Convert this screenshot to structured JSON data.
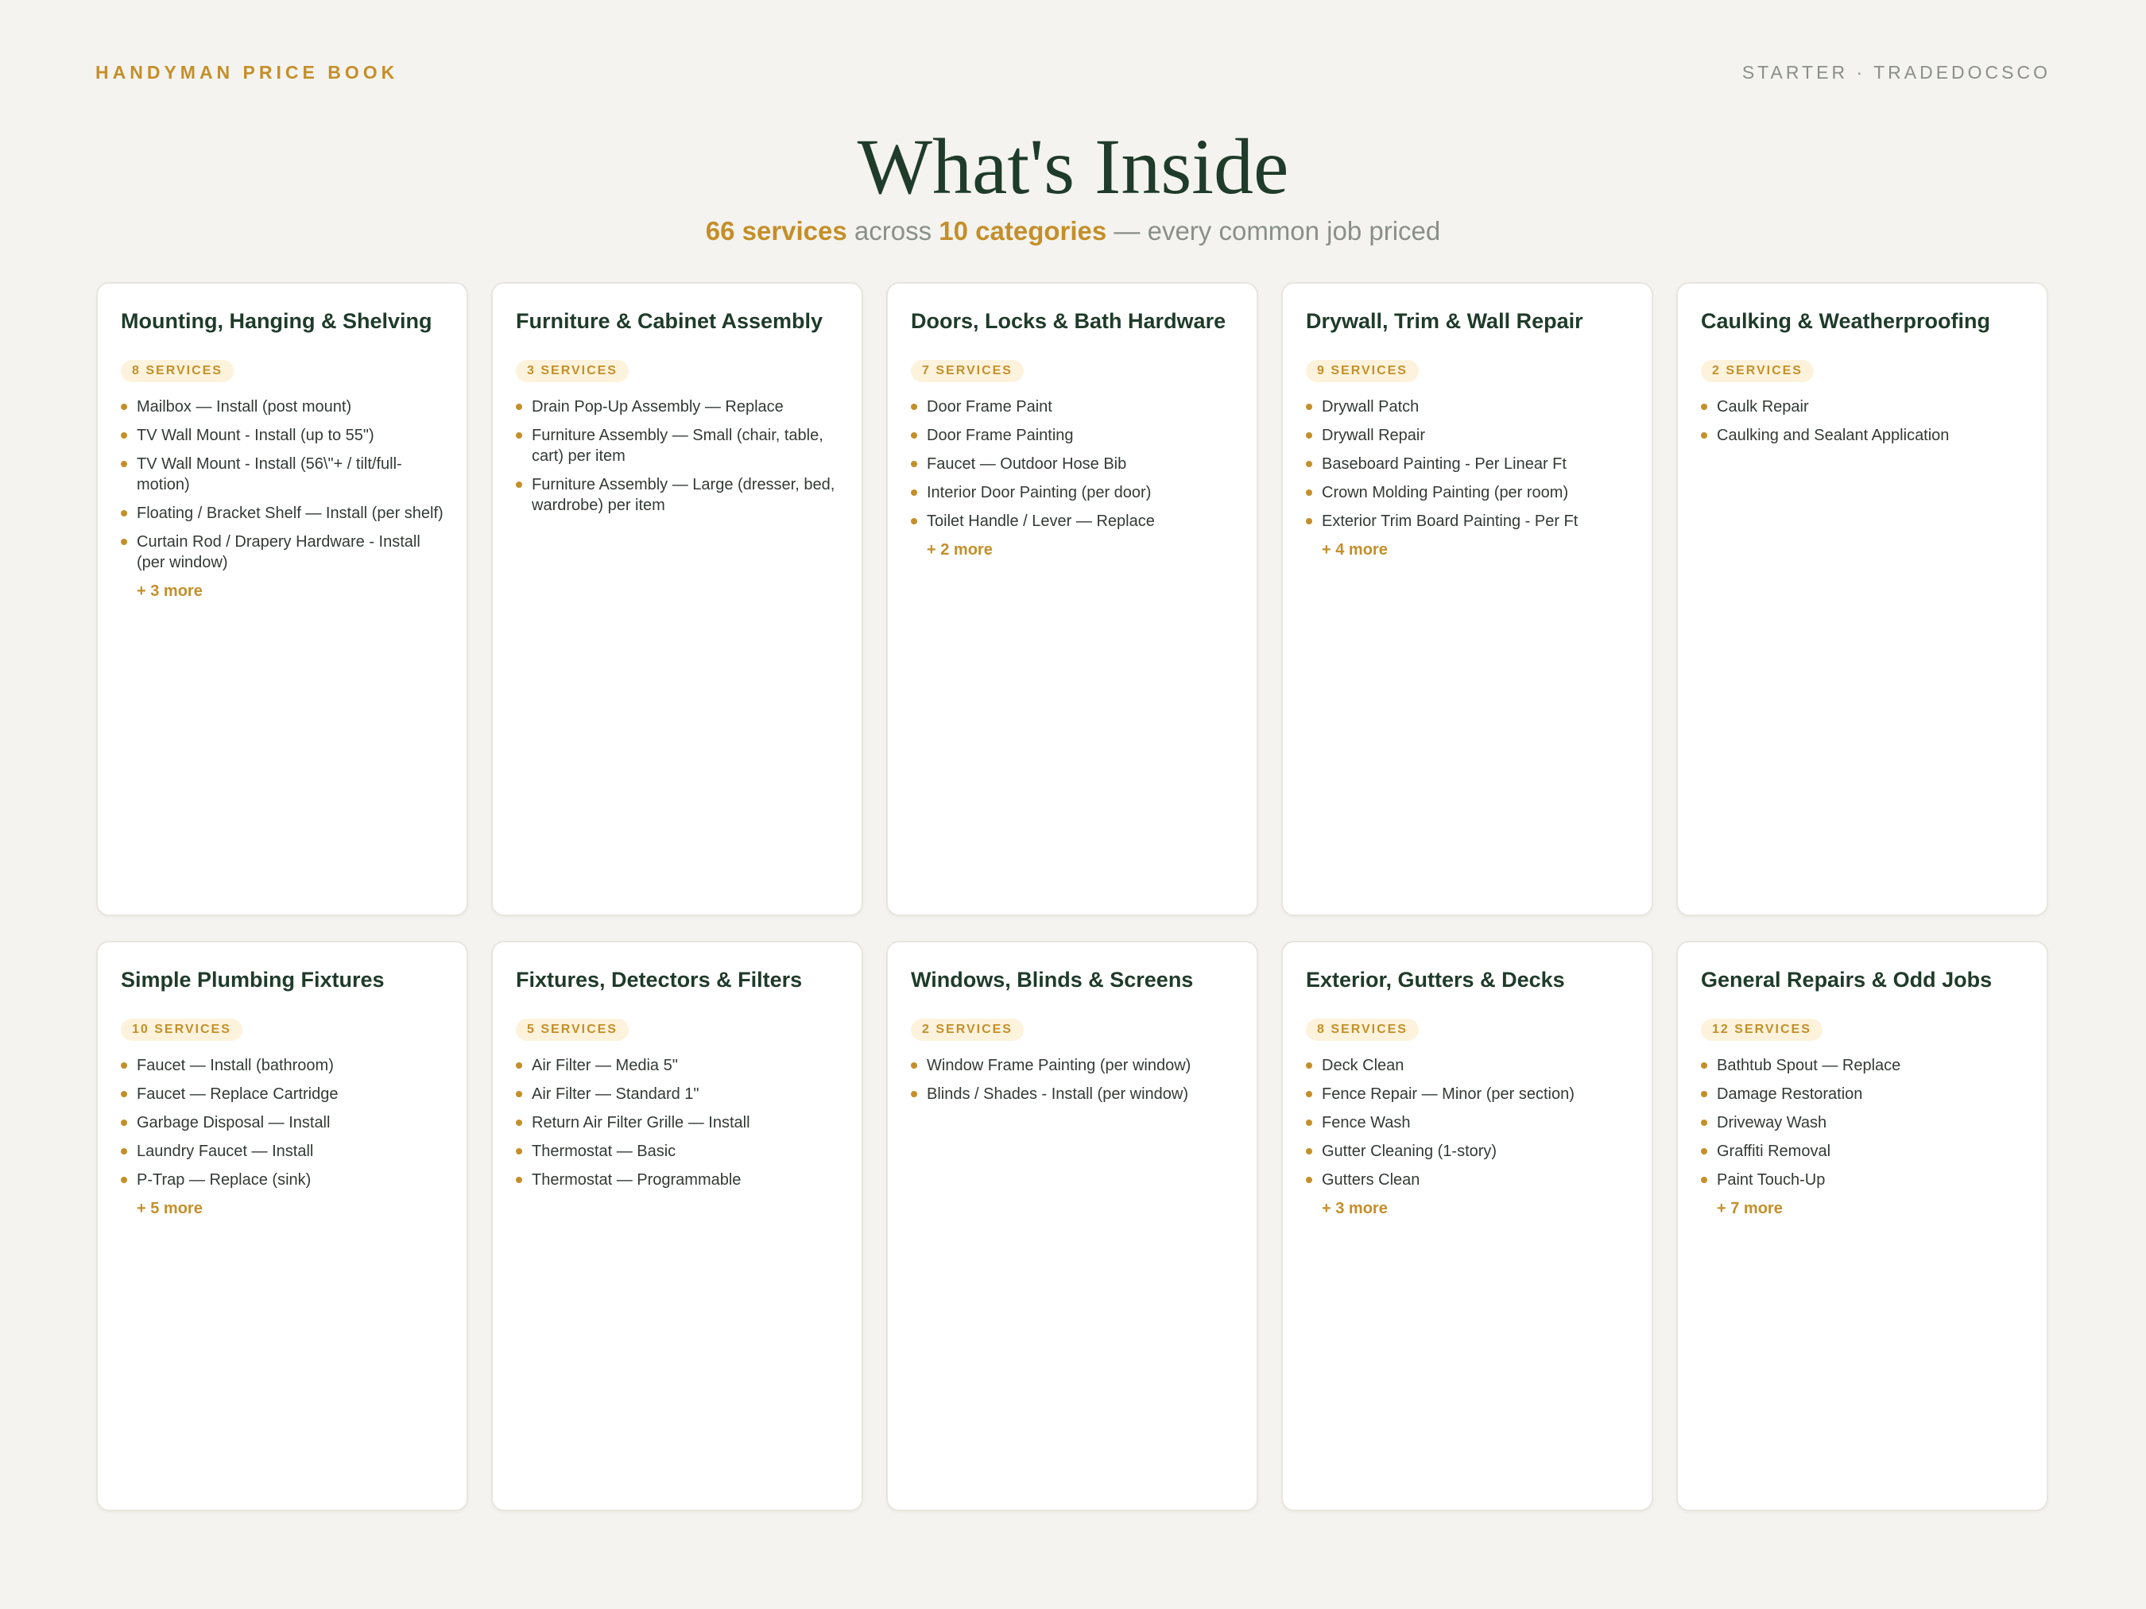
{
  "header": {
    "brand": "HANDYMAN PRICE BOOK",
    "edition": "STARTER · TRADEDOCSCO"
  },
  "hero": {
    "title": "What's Inside",
    "services_count": "66 services",
    "across": " across ",
    "categories_count": "10 categories",
    "tail": " — every common job priced"
  },
  "categories": [
    {
      "title": "Mounting, Hanging & Shelving",
      "badge": "8 SERVICES",
      "items": [
        "Mailbox — Install (post mount)",
        "TV Wall Mount - Install (up to 55\")",
        "TV Wall Mount - Install (56\\\"+ / tilt/full-motion)",
        "Floating / Bracket Shelf — Install (per shelf)",
        "Curtain Rod / Drapery Hardware - Install (per window)"
      ],
      "more": "+ 3 more"
    },
    {
      "title": "Furniture & Cabinet Assembly",
      "badge": "3 SERVICES",
      "items": [
        "Drain Pop-Up Assembly — Replace",
        "Furniture Assembly — Small (chair, table, cart) per item",
        "Furniture Assembly — Large (dresser, bed, wardrobe) per item"
      ],
      "more": ""
    },
    {
      "title": "Doors, Locks & Bath Hardware",
      "badge": "7 SERVICES",
      "items": [
        "Door Frame Paint",
        "Door Frame Painting",
        "Faucet — Outdoor Hose Bib",
        "Interior Door Painting (per door)",
        "Toilet Handle / Lever — Replace"
      ],
      "more": "+ 2 more"
    },
    {
      "title": "Drywall, Trim & Wall Repair",
      "badge": "9 SERVICES",
      "items": [
        "Drywall Patch",
        "Drywall Repair",
        "Baseboard Painting - Per Linear Ft",
        "Crown Molding Painting (per room)",
        "Exterior Trim Board Painting - Per Ft"
      ],
      "more": "+ 4 more"
    },
    {
      "title": "Caulking & Weatherproofing",
      "badge": "2 SERVICES",
      "items": [
        "Caulk Repair",
        "Caulking and Sealant Application"
      ],
      "more": ""
    },
    {
      "title": "Simple Plumbing Fixtures",
      "badge": "10 SERVICES",
      "items": [
        "Faucet — Install (bathroom)",
        "Faucet — Replace Cartridge",
        "Garbage Disposal — Install",
        "Laundry Faucet — Install",
        "P-Trap — Replace (sink)"
      ],
      "more": "+ 5 more"
    },
    {
      "title": "Fixtures, Detectors & Filters",
      "badge": "5 SERVICES",
      "items": [
        "Air Filter — Media 5\"",
        "Air Filter — Standard 1\"",
        "Return Air Filter Grille — Install",
        "Thermostat — Basic",
        "Thermostat — Programmable"
      ],
      "more": ""
    },
    {
      "title": "Windows, Blinds & Screens",
      "badge": "2 SERVICES",
      "items": [
        "Window Frame Painting (per window)",
        "Blinds / Shades - Install (per window)"
      ],
      "more": ""
    },
    {
      "title": "Exterior, Gutters & Decks",
      "badge": "8 SERVICES",
      "items": [
        "Deck Clean",
        "Fence Repair — Minor (per section)",
        "Fence Wash",
        "Gutter Cleaning (1-story)",
        "Gutters Clean"
      ],
      "more": "+ 3 more"
    },
    {
      "title": "General Repairs & Odd Jobs",
      "badge": "12 SERVICES",
      "items": [
        "Bathtub Spout — Replace",
        "Damage Restoration",
        "Driveway Wash",
        "Graffiti Removal",
        "Paint Touch-Up"
      ],
      "more": "+ 7 more"
    }
  ],
  "colors": {
    "accent": "#c48f2a",
    "title_green": "#1f3b2a",
    "background": "#f4f3ef",
    "badge_bg": "#fdf3dc"
  }
}
